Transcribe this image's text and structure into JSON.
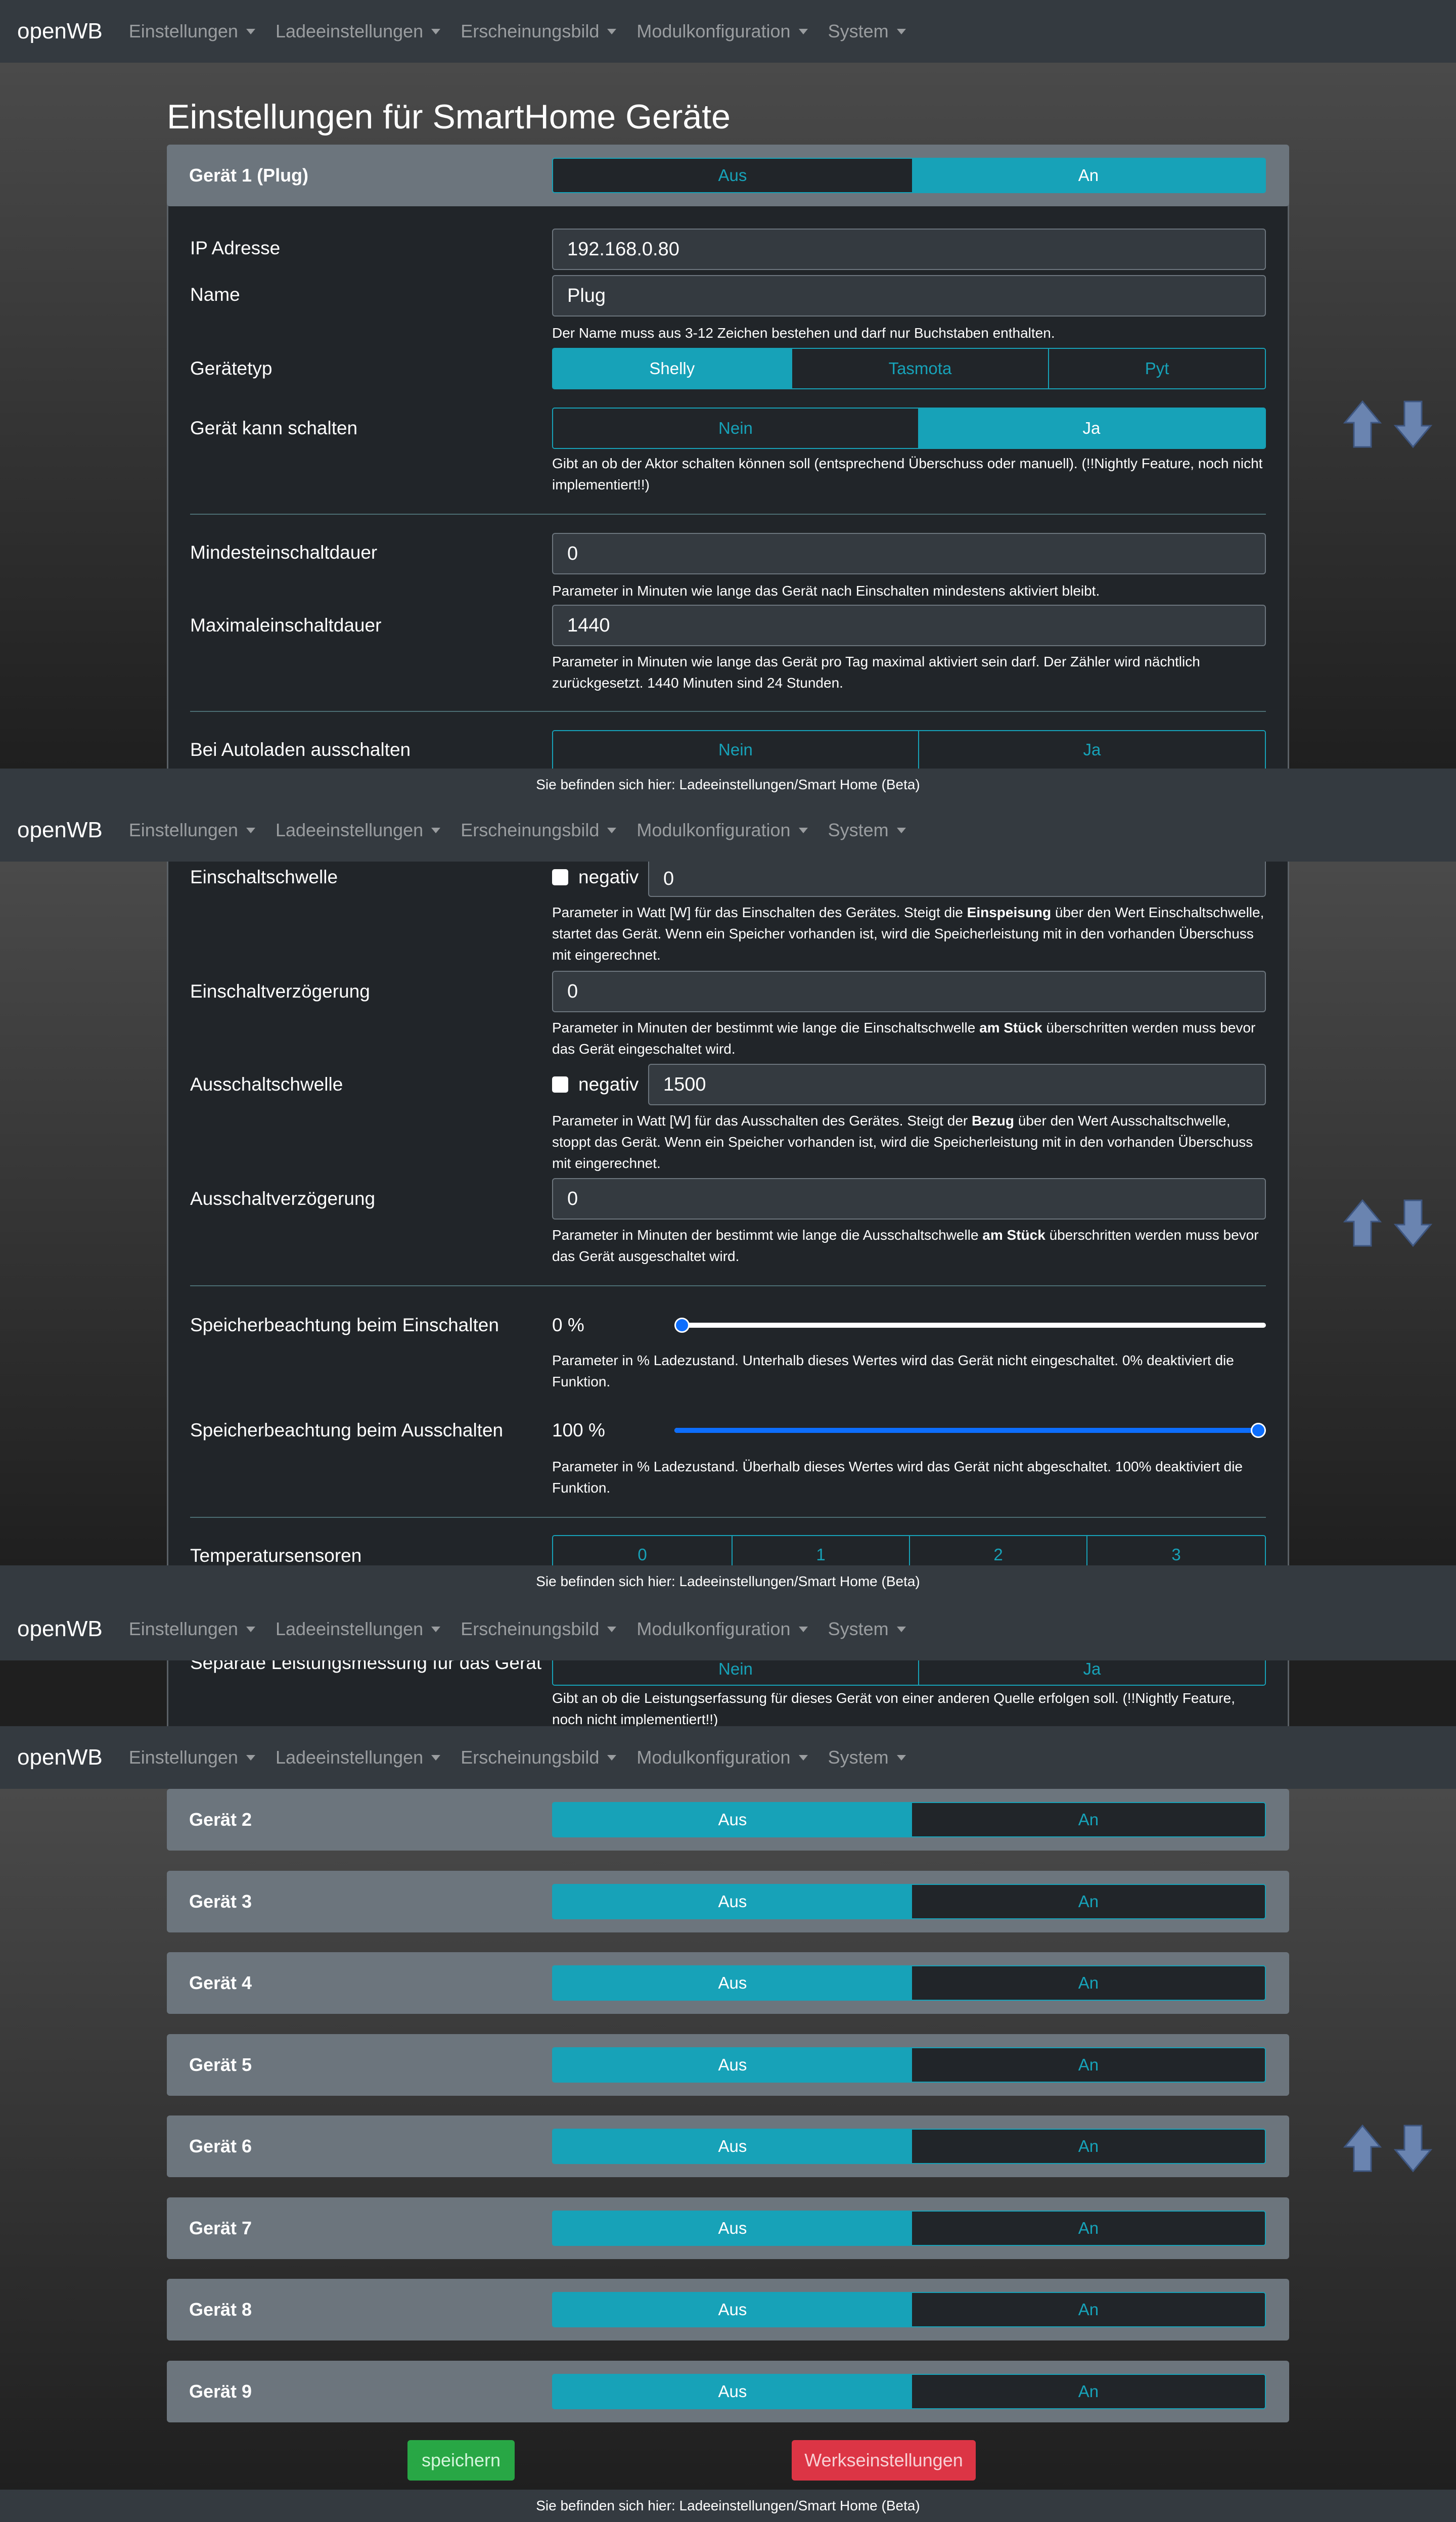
{
  "nav": {
    "brand": "openWB",
    "items": [
      "Einstellungen",
      "Ladeeinstellungen",
      "Erscheinungsbild",
      "Modulkonfiguration",
      "System"
    ]
  },
  "footer": "Sie befinden sich hier: Ladeeinstellungen/Smart Home (Beta)",
  "page_title": "Einstellungen für SmartHome Geräte",
  "device1": {
    "title": "Gerät 1 (Plug)",
    "toggle_off": "Aus",
    "toggle_on": "An",
    "ip_label": "IP Adresse",
    "ip_value": "192.168.0.80",
    "name_label": "Name",
    "name_value": "Plug",
    "name_hint": "Der Name muss aus 3-12 Zeichen bestehen und darf nur Buchstaben enthalten.",
    "type_label": "Gerätetyp",
    "type_options": [
      "Shelly",
      "Tasmota",
      "Pyt"
    ],
    "switch_label": "Gerät kann schalten",
    "no": "Nein",
    "yes": "Ja",
    "switch_hint": "Gibt an ob der Aktor schalten können soll (entsprechend Überschuss oder manuell). (!!Nightly Feature, noch nicht implementiert!!)",
    "min_label": "Mindesteinschaltdauer",
    "min_value": "0",
    "min_hint": "Parameter in Minuten wie lange das Gerät nach Einschalten mindestens aktiviert bleibt.",
    "max_label": "Maximaleinschaltdauer",
    "max_value": "1440",
    "max_hint": "Parameter in Minuten wie lange das Gerät pro Tag maximal aktiviert sein darf. Der Zähler wird nächtlich zurückgesetzt. 1440 Minuten sind 24 Stunden.",
    "autoload_label": "Bei Autoladen ausschalten",
    "on_threshold_label": "Einschaltschwelle",
    "negativ": "negativ",
    "on_threshold_value": "0",
    "on_threshold_hint_a": "Parameter in Watt [W] für das Einschalten des Gerätes. Steigt die ",
    "on_threshold_hint_b": "Einspeisung",
    "on_threshold_hint_c": " über den Wert Einschaltschwelle, startet das Gerät. Wenn ein Speicher vorhanden ist, wird die Speicherleistung mit in den vorhanden Überschuss mit eingerechnet.",
    "on_delay_label": "Einschaltverzögerung",
    "on_delay_value": "0",
    "on_delay_hint_a": "Parameter in Minuten der bestimmt wie lange die Einschaltschwelle ",
    "on_delay_hint_b": "am Stück",
    "on_delay_hint_c": " überschritten werden muss bevor das Gerät eingeschaltet wird.",
    "off_threshold_label": "Ausschaltschwelle",
    "off_threshold_value": "1500",
    "off_threshold_hint_a": "Parameter in Watt [W] für das Ausschalten des Gerätes. Steigt der ",
    "off_threshold_hint_b": "Bezug",
    "off_threshold_hint_c": " über den Wert Ausschaltschwelle, stoppt das Gerät. Wenn ein Speicher vorhanden ist, wird die Speicherleistung mit in den vorhanden Überschuss mit eingerechnet.",
    "off_delay_label": "Ausschaltverzögerung",
    "off_delay_value": "0",
    "off_delay_hint_a": "Parameter in Minuten der bestimmt wie lange die Ausschaltschwelle ",
    "off_delay_hint_b": "am Stück",
    "off_delay_hint_c": " überschritten werden muss bevor das Gerät ausgeschaltet wird.",
    "storage_on_label": "Speicherbeachtung beim Einschalten",
    "storage_on_value": "0 %",
    "storage_on_fraction": 0.0,
    "storage_on_hint": "Parameter in % Ladezustand. Unterhalb dieses Wertes wird das Gerät nicht eingeschaltet. 0% deaktiviert die Funktion.",
    "storage_off_label": "Speicherbeachtung beim Ausschalten",
    "storage_off_value": "100 %",
    "storage_off_fraction": 1.0,
    "storage_off_hint": "Parameter in % Ladezustand. Überhalb dieses Wertes wird das Gerät nicht abgeschaltet. 100% deaktiviert die Funktion.",
    "temp_label": "Temperatursensoren",
    "temp_options": [
      "0",
      "1",
      "2",
      "3"
    ],
    "separate_label": "Separate Leistungsmessung für das Gerät",
    "separate_hint": "Gibt an ob die Leistungserfassung für dieses Gerät von einer anderen Quelle erfolgen soll. (!!Nightly Feature, noch nicht implementiert!!)"
  },
  "devices": [
    {
      "title": "Gerät 2",
      "off": "Aus",
      "on": "An"
    },
    {
      "title": "Gerät 3",
      "off": "Aus",
      "on": "An"
    },
    {
      "title": "Gerät 4",
      "off": "Aus",
      "on": "An"
    },
    {
      "title": "Gerät 5",
      "off": "Aus",
      "on": "An"
    },
    {
      "title": "Gerät 6",
      "off": "Aus",
      "on": "An"
    },
    {
      "title": "Gerät 7",
      "off": "Aus",
      "on": "An"
    },
    {
      "title": "Gerät 8",
      "off": "Aus",
      "on": "An"
    },
    {
      "title": "Gerät 9",
      "off": "Aus",
      "on": "An"
    }
  ],
  "buttons": {
    "save": "speichern",
    "reset": "Werkseinstellungen"
  },
  "colors": {
    "accent": "#17a2b8",
    "save": "#28a745",
    "reset": "#dc3545",
    "slider": "#0d6efd"
  },
  "icons": {
    "scroll": "up-down-arrows-icon"
  }
}
